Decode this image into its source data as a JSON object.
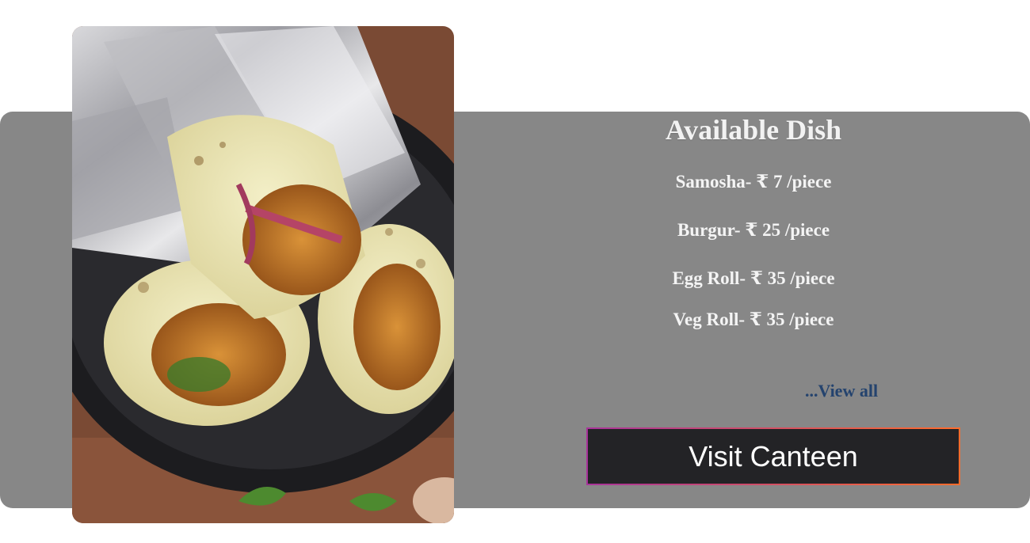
{
  "section": {
    "title": "Available Dish",
    "dishes": [
      {
        "text": "Samosha- ₹ 7 /piece"
      },
      {
        "text": "Burgur- ₹ 25 /piece"
      },
      {
        "text": "Egg Roll- ₹ 35 /piece"
      },
      {
        "text": "Veg Roll- ₹ 35 /piece"
      }
    ],
    "view_all": "...View all",
    "visit_button": "Visit Canteen"
  },
  "colors": {
    "panel": "#878787",
    "link": "#24436e",
    "button_bg": "#232326",
    "button_border_start": "#a8339a",
    "button_border_end": "#ff6c2c"
  }
}
